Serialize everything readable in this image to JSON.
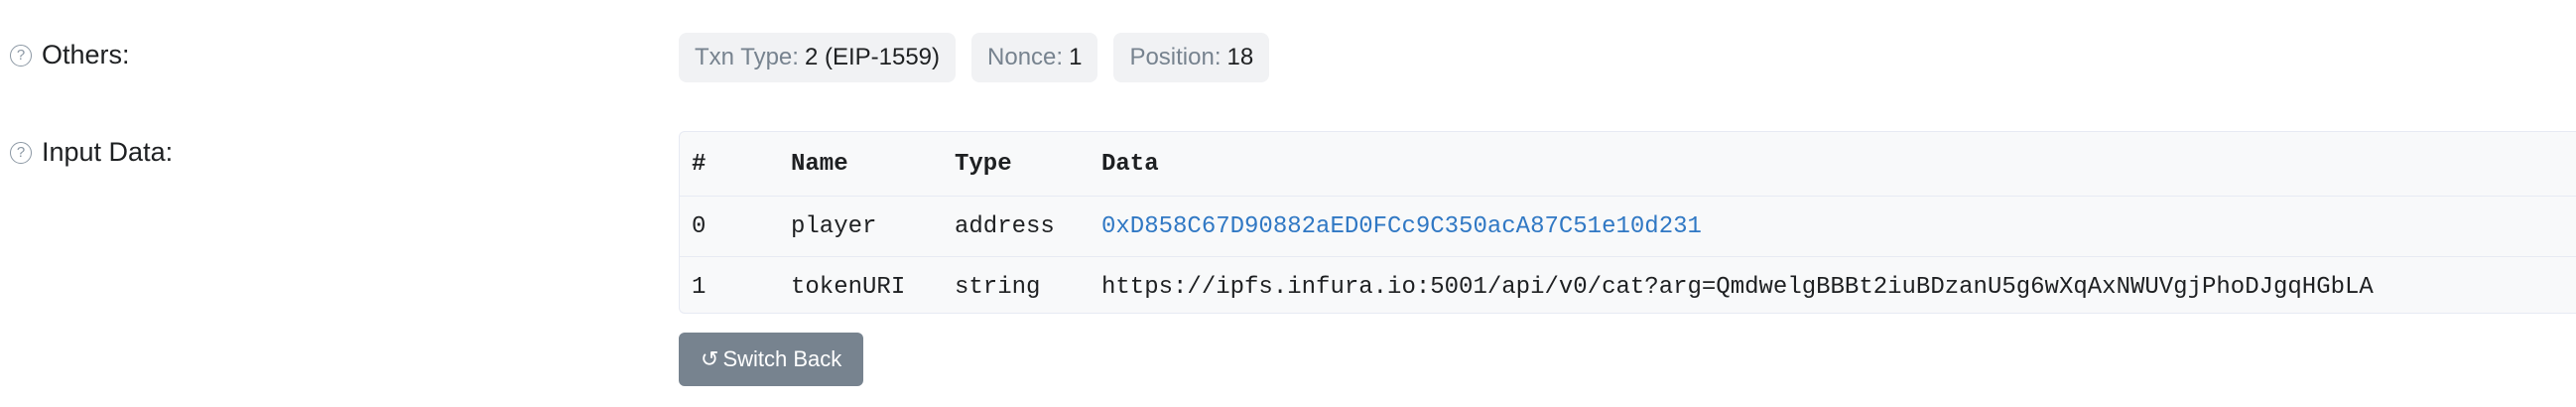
{
  "others": {
    "label": "Others:",
    "help_icon": "?",
    "chips": [
      {
        "key": "Txn Type:",
        "value": "2 (EIP-1559)"
      },
      {
        "key": "Nonce:",
        "value": "1"
      },
      {
        "key": "Position:",
        "value": "18"
      }
    ]
  },
  "input_data": {
    "label": "Input Data:",
    "help_icon": "?",
    "headers": {
      "idx": "#",
      "name": "Name",
      "type": "Type",
      "data": "Data"
    },
    "rows": [
      {
        "idx": "0",
        "name": "player",
        "type": "address",
        "data": "0xD858C67D90882aED0FCc9C350acA87C51e10d231"
      },
      {
        "idx": "1",
        "name": "tokenURI",
        "type": "string",
        "data": "https://ipfs.infura.io:5001/api/v0/cat?arg=QmdwelgBBBt2iuBDzanU5g6wXqAxNWUVgjPhoDJgqHGbLA"
      }
    ],
    "switch_icon": "↺",
    "switch_label": "Switch Back"
  },
  "colors": {
    "link": "#3078c4",
    "chip_bg": "#f1f2f4",
    "button_bg": "#77838f"
  }
}
